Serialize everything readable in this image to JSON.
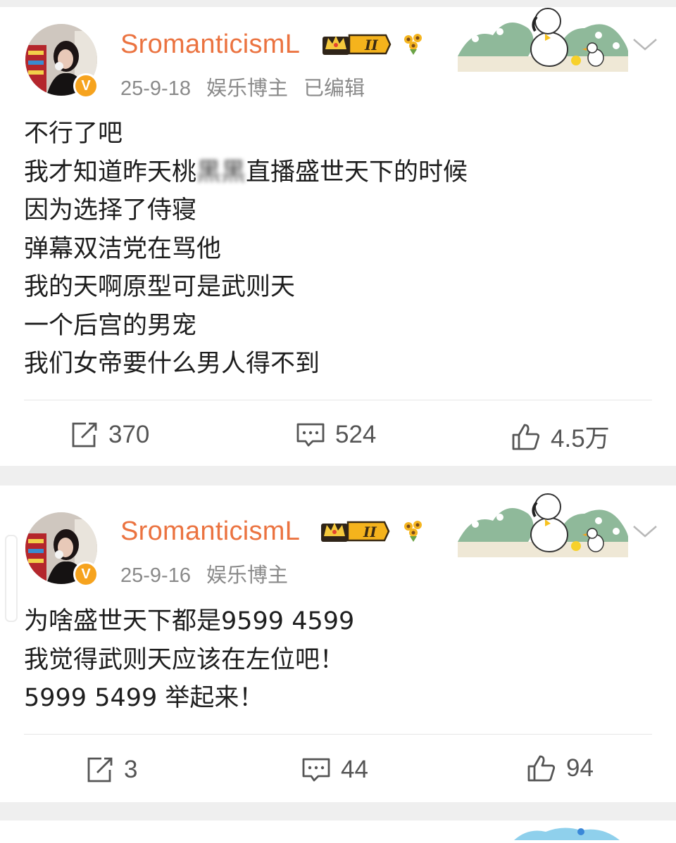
{
  "posts": [
    {
      "username": "SromanticismL",
      "level": "II",
      "date": "25-9-18",
      "role": "娱乐博主",
      "edited": "已编辑",
      "lines": [
        "不行了吧",
        "我才知道昨天桃",
        "黑黑",
        "直播盛世天下的时候",
        "因为选择了侍寝",
        "弹幕双洁党在骂他",
        "我的天啊原型可是武则天",
        "一个后宫的男宠",
        "我们女帝要什么男人得不到"
      ],
      "repost_count": "370",
      "comment_count": "524",
      "like_count": "4.5万"
    },
    {
      "username": "SromanticismL",
      "level": "II",
      "date": "25-9-16",
      "role": "娱乐博主",
      "lines": [
        "为啥盛世天下都是9599 4599",
        "我觉得武则天应该在左位吧！",
        "5999 5499 举起来！"
      ],
      "repost_count": "3",
      "comment_count": "44",
      "like_count": "94"
    }
  ],
  "icons": {
    "repost": "repost-icon",
    "comment": "comment-icon",
    "like": "thumbs-up-icon",
    "more": "chevron-down-icon",
    "verified": "verified-v-badge",
    "crown": "crown-level-badge",
    "flower": "sunflower-icon"
  },
  "colors": {
    "username": "#eb7340",
    "meta": "#8a8a8a",
    "badge": "#f6a31e",
    "separator": "#efefef"
  }
}
